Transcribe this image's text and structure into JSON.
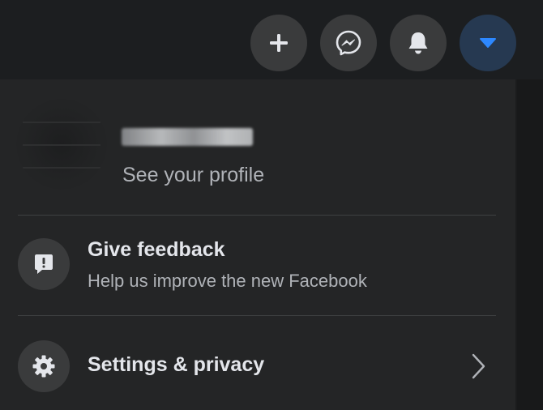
{
  "topbar": {
    "create_icon": "plus-icon",
    "messenger_icon": "messenger-icon",
    "notifications_icon": "bell-icon",
    "account_icon": "caret-down-icon",
    "accent_color": "#2d88ff"
  },
  "menu": {
    "profile": {
      "subtitle": "See your profile"
    },
    "feedback": {
      "title": "Give feedback",
      "subtitle": "Help us improve the new Facebook",
      "icon": "feedback-icon"
    },
    "settings": {
      "title": "Settings & privacy",
      "icon": "gear-icon",
      "arrow_icon": "chevron-right-icon"
    }
  }
}
